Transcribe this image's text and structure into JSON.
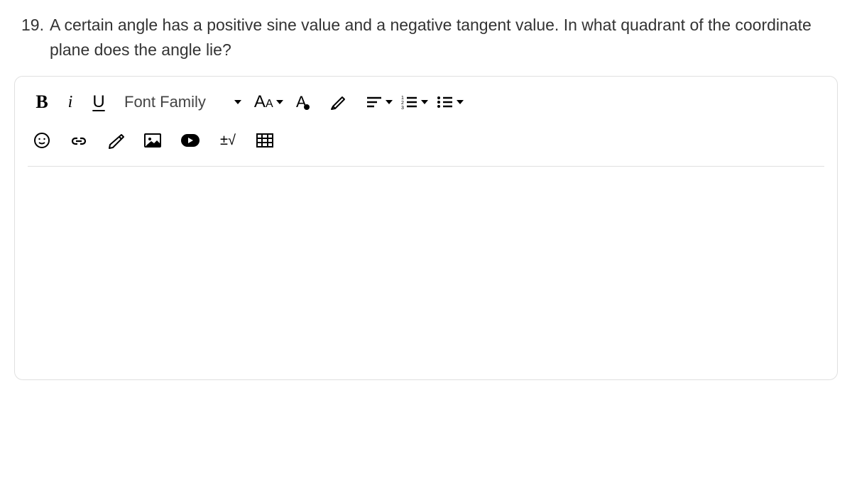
{
  "question": {
    "number": "19.",
    "text": "A certain angle has a positive sine value and a negative tangent value. In what quadrant of the coordinate plane does the angle lie?"
  },
  "toolbar": {
    "bold": "B",
    "italic": "i",
    "underline": "U",
    "fontFamily": "Font Family",
    "fontSizeBig": "A",
    "fontSizeSmall": "A",
    "mathSymbol": "±√"
  }
}
